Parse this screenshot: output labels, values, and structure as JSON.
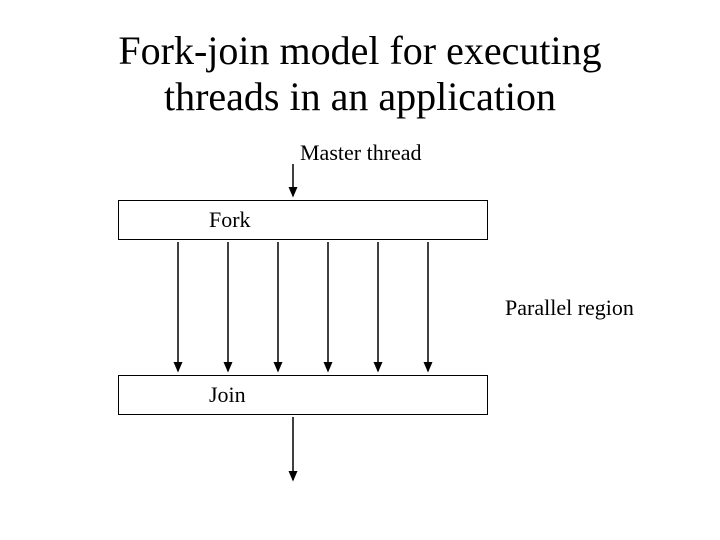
{
  "title_line1": "Fork-join model for executing",
  "title_line2": "threads in an application",
  "master_label": "Master thread",
  "fork_label": "Fork",
  "parallel_label": "Parallel region",
  "join_label": "Join",
  "diagram": {
    "num_threads": 6,
    "stages": [
      "Master thread",
      "Fork",
      "Parallel region",
      "Join"
    ]
  }
}
